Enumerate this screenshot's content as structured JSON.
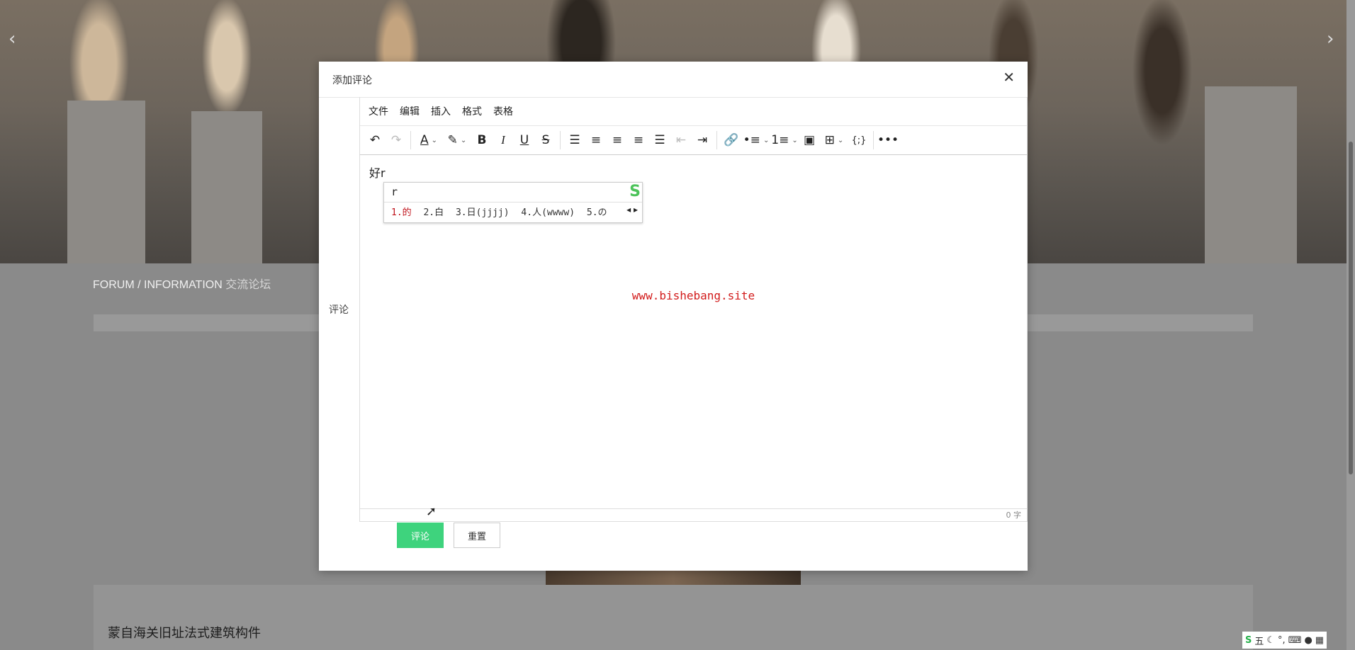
{
  "background": {
    "breadcrumb": {
      "en": "FORUM / INFORMATION",
      "cn": "交流论坛"
    },
    "card_title": "蒙自海关旧址法式建筑构件",
    "hero_prev": "‹",
    "hero_next": "›",
    "ime_tray": {
      "logo": "S",
      "mode": "五"
    }
  },
  "modal": {
    "title": "添加评论",
    "close": "✕",
    "field_label": "评论",
    "menubar": [
      "文件",
      "编辑",
      "插入",
      "格式",
      "表格"
    ],
    "editor": {
      "typed_text": "好r",
      "watermark": "www.bishebang.site",
      "word_count": "0 字"
    },
    "ime": {
      "composition": "r",
      "logo": "S",
      "candidates": [
        "1.的",
        "2.白",
        "3.日(jjjj)",
        "4.人(wwww)",
        "5.の"
      ],
      "arrows": "◂ ▸"
    },
    "buttons": {
      "submit": "评论",
      "reset": "重置"
    }
  },
  "toolbar_icons": [
    "undo-icon",
    "redo-icon",
    "font-color-icon",
    "highlight-icon",
    "bold-icon",
    "italic-icon",
    "underline-icon",
    "strikethrough-icon",
    "line-height-icon",
    "align-left-icon",
    "align-center-icon",
    "align-right-icon",
    "justify-icon",
    "outdent-icon",
    "indent-icon",
    "link-icon",
    "bullet-list-icon",
    "numbered-list-icon",
    "image-icon",
    "table-icon",
    "code-icon",
    "more-icon"
  ],
  "colors": {
    "accent": "#3ed37d",
    "watermark": "#d21b1b",
    "ime_highlight": "#c0141d"
  }
}
